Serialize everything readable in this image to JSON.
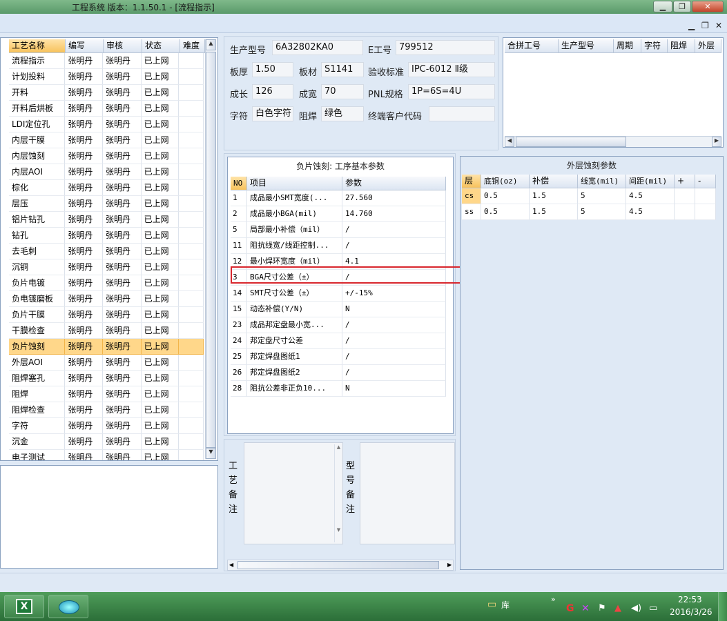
{
  "window": {
    "title": "工程系统   版本：1.1.50.1 - [流程指示]"
  },
  "process_list": {
    "headers": [
      "工艺名称",
      "编写",
      "审核",
      "状态",
      "难度"
    ],
    "rows": [
      [
        "流程指示",
        "张明丹",
        "张明丹",
        "已上网",
        ""
      ],
      [
        "计划投料",
        "张明丹",
        "张明丹",
        "已上网",
        ""
      ],
      [
        "开料",
        "张明丹",
        "张明丹",
        "已上网",
        ""
      ],
      [
        "开料后烘板",
        "张明丹",
        "张明丹",
        "已上网",
        ""
      ],
      [
        "LDI定位孔",
        "张明丹",
        "张明丹",
        "已上网",
        ""
      ],
      [
        "内层干膜",
        "张明丹",
        "张明丹",
        "已上网",
        ""
      ],
      [
        "内层蚀刻",
        "张明丹",
        "张明丹",
        "已上网",
        ""
      ],
      [
        "内层AOI",
        "张明丹",
        "张明丹",
        "已上网",
        ""
      ],
      [
        "棕化",
        "张明丹",
        "张明丹",
        "已上网",
        ""
      ],
      [
        "层压",
        "张明丹",
        "张明丹",
        "已上网",
        ""
      ],
      [
        "铝片钻孔",
        "张明丹",
        "张明丹",
        "已上网",
        ""
      ],
      [
        "钻孔",
        "张明丹",
        "张明丹",
        "已上网",
        ""
      ],
      [
        "去毛刺",
        "张明丹",
        "张明丹",
        "已上网",
        ""
      ],
      [
        "沉铜",
        "张明丹",
        "张明丹",
        "已上网",
        ""
      ],
      [
        "负片电镀",
        "张明丹",
        "张明丹",
        "已上网",
        ""
      ],
      [
        "负电镀磨板",
        "张明丹",
        "张明丹",
        "已上网",
        ""
      ],
      [
        "负片干膜",
        "张明丹",
        "张明丹",
        "已上网",
        ""
      ],
      [
        "干膜检查",
        "张明丹",
        "张明丹",
        "已上网",
        ""
      ],
      [
        "负片蚀刻",
        "张明丹",
        "张明丹",
        "已上网",
        ""
      ],
      [
        "外层AOI",
        "张明丹",
        "张明丹",
        "已上网",
        ""
      ],
      [
        "阻焊塞孔",
        "张明丹",
        "张明丹",
        "已上网",
        ""
      ],
      [
        "阻焊",
        "张明丹",
        "张明丹",
        "已上网",
        ""
      ],
      [
        "阻焊检查",
        "张明丹",
        "张明丹",
        "已上网",
        ""
      ],
      [
        "字符",
        "张明丹",
        "张明丹",
        "已上网",
        ""
      ],
      [
        "沉金",
        "张明丹",
        "张明丹",
        "已上网",
        ""
      ],
      [
        "电子测试",
        "张明丹",
        "张明丹",
        "已上网",
        ""
      ]
    ],
    "selected_index": 18
  },
  "info": {
    "model_label": "生产型号",
    "model_value": "6A32802KA0",
    "eno_label": "E工号",
    "eno_value": "799512",
    "thickness_label": "板厚",
    "thickness_value": "1.50",
    "material_label": "板材",
    "material_value": "S1141",
    "standard_label": "验收标准",
    "standard_value": "IPC-6012 Ⅱ级",
    "length_label": "成长",
    "length_value": "126",
    "width_label": "成宽",
    "width_value": "70",
    "pnl_label": "PNL规格",
    "pnl_value": "1P=6S=4U",
    "char_label": "字符",
    "char_value": "白色字符",
    "mask_label": "阻焊",
    "mask_value": "绿色",
    "client_label": "终端客户代码",
    "client_value": ""
  },
  "merge_table": {
    "headers": [
      "合拼工号",
      "生产型号",
      "周期",
      "字符",
      "阻焊",
      "外层"
    ]
  },
  "params": {
    "title": "负片蚀刻: 工序基本参数",
    "headers": [
      "NO",
      "项目",
      "参数"
    ],
    "rows": [
      [
        "1",
        "成品最小SMT宽度(...",
        "27.560"
      ],
      [
        "2",
        "成品最小BGA(mil)",
        "14.760"
      ],
      [
        "5",
        "局部最小补偿（mil）",
        "/"
      ],
      [
        "11",
        "阻抗线宽/线距控制...",
        "/"
      ],
      [
        "12",
        "最小焊环宽度（mil）",
        "4.1"
      ],
      [
        "3",
        "BGA尺寸公差（±）",
        "/"
      ],
      [
        "14",
        "SMT尺寸公差（±）",
        "+/-15%"
      ],
      [
        "15",
        "动态补偿(Y/N)",
        "N"
      ],
      [
        "23",
        "成品邦定盘最小宽...",
        "/"
      ],
      [
        "24",
        "邦定盘尺寸公差",
        "/"
      ],
      [
        "25",
        "邦定焊盘图纸1",
        "/"
      ],
      [
        "26",
        "邦定焊盘图纸2",
        "/"
      ],
      [
        "28",
        "阻抗公差非正负10...",
        "N"
      ]
    ]
  },
  "outer": {
    "title": "外层蚀刻参数",
    "headers": [
      "层",
      "底铜(oz)",
      "补偿",
      "线宽(mil)",
      "间距(mil)",
      "+",
      "-"
    ],
    "rows": [
      [
        "cs",
        "0.5",
        "1.5",
        "5",
        "4.5",
        "",
        ""
      ],
      [
        "ss",
        "0.5",
        "1.5",
        "5",
        "4.5",
        "",
        ""
      ]
    ]
  },
  "notes": {
    "process_label": "工\n艺\n备\n注",
    "model_label": "型\n号\n备\n注"
  },
  "taskbar": {
    "folder_label": "库",
    "time": "22:53",
    "date": "2016/3/26"
  }
}
